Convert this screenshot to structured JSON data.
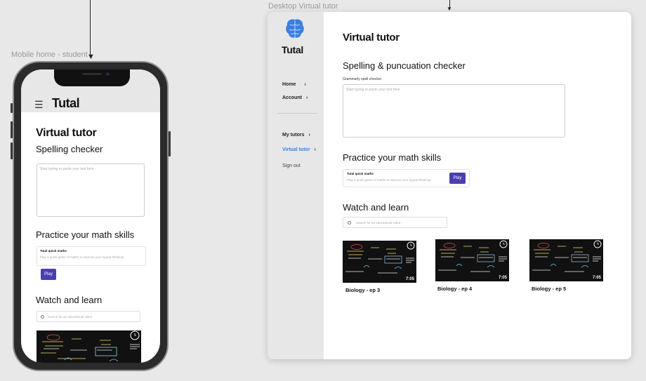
{
  "frames": {
    "mobile_label": "Mobile home - student",
    "desktop_label": "Desktop Virtual tutor"
  },
  "brand": {
    "name": "Tutal",
    "logo_icon": "brain-icon",
    "accent": "#3a7fe0"
  },
  "mobile": {
    "menu_icon": "hamburger-icon",
    "title": "Virtual tutor",
    "spelling_heading": "Spelling checker",
    "spelling_placeholder": "Start typing or paste your text here",
    "math_heading": "Practice your math skills",
    "quiz_title": "Tutal quick maths",
    "quiz_desc": "Play a quick game of maths to improve your logical thinking!",
    "play_label": "Play",
    "watch_heading": "Watch and learn",
    "search_placeholder": "Search for an educational video"
  },
  "desktop": {
    "nav": [
      {
        "label": "Home",
        "chevron": "›"
      },
      {
        "label": "Account",
        "chevron": "›"
      },
      {
        "label": "My tutors",
        "chevron": "›"
      },
      {
        "label": "Virtual tutor",
        "chevron": "›"
      },
      {
        "label": "Sign out"
      }
    ],
    "title": "Virtual tutor",
    "spelling_heading": "Spelling & puncuation checker",
    "spelling_sub": "Grammarly spell checker",
    "spelling_placeholder": "Start typing or paste your text here",
    "math_heading": "Practice your math skills",
    "quiz_title": "Tutal quick maths",
    "quiz_desc": "Play a quick game of maths to improve your logical thinking!",
    "play_label": "Play",
    "watch_heading": "Watch and learn",
    "search_placeholder": "Search for an educational video",
    "videos": [
      {
        "title": "Biology - ep 3",
        "duration": "7:05"
      },
      {
        "title": "Biology - ep 4",
        "duration": "7:05"
      },
      {
        "title": "Biology - ep 5",
        "duration": "7:05"
      }
    ]
  },
  "colors": {
    "play_button": "#4a3fb0",
    "sidebar_bg": "#e7e7e7",
    "canvas_bg": "#e8e8e8"
  }
}
